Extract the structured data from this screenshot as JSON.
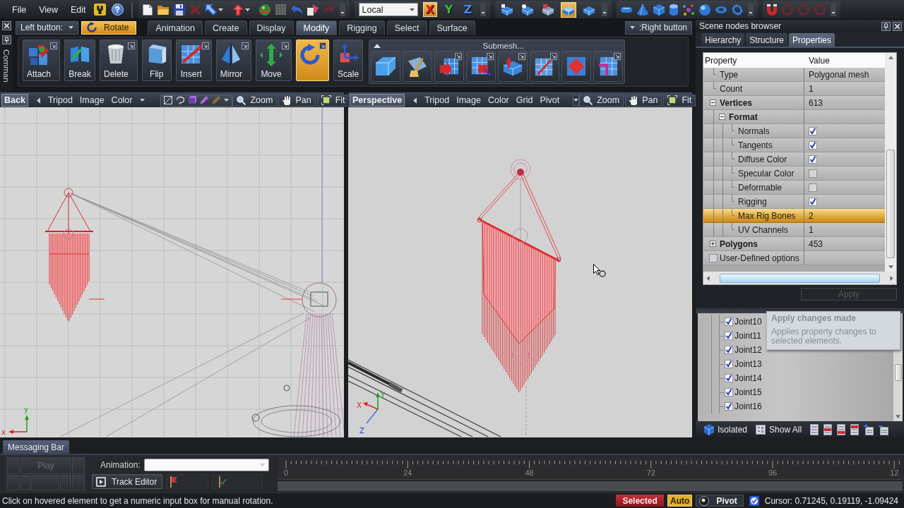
{
  "menu": {
    "items": [
      "File",
      "View",
      "Edit"
    ],
    "help": "?"
  },
  "toolbar": {
    "space": "Local",
    "axes": [
      {
        "label": "X",
        "selected": true
      },
      {
        "label": "Y",
        "selected": false
      },
      {
        "label": "Z",
        "selected": false
      }
    ],
    "selection_modes": [
      {
        "selected": false
      },
      {
        "selected": false
      },
      {
        "selected": false
      },
      {
        "selected": true
      },
      {
        "selected": false
      }
    ]
  },
  "command_panel": {
    "title": "Comman",
    "left_button": "Left button:",
    "left_tool": "Rotate",
    "right_button": ":Right button",
    "tabs": [
      {
        "label": "Animation",
        "selected": false
      },
      {
        "label": "Create",
        "selected": false
      },
      {
        "label": "Display",
        "selected": false
      },
      {
        "label": "Modify",
        "selected": true
      },
      {
        "label": "Rigging",
        "selected": false
      },
      {
        "label": "Select",
        "selected": false
      },
      {
        "label": "Surface",
        "selected": false
      }
    ],
    "tools": [
      {
        "kind": "attach",
        "label": "Attach",
        "options": true,
        "selected": false
      },
      {
        "kind": "break",
        "label": "Break",
        "options": false,
        "selected": false
      },
      {
        "kind": "delete",
        "label": "Delete",
        "options": true,
        "selected": false
      },
      {
        "kind": "flip",
        "label": "Flip",
        "options": false,
        "selected": false
      },
      {
        "kind": "insert",
        "label": "Insert",
        "options": true,
        "selected": false
      },
      {
        "kind": "mirror",
        "label": "Mirror",
        "options": true,
        "selected": false
      },
      {
        "kind": "move",
        "label": "Move",
        "options": true,
        "selected": false
      },
      {
        "kind": "rotate",
        "options": true,
        "selected": true
      },
      {
        "kind": "scale",
        "label": "Scale",
        "options": false,
        "selected": false
      }
    ],
    "submesh": {
      "title": "Submesh...",
      "tools": [
        {
          "options": false
        },
        {
          "options": false
        },
        {
          "options": true
        },
        {
          "options": true
        },
        {
          "options": true
        },
        {
          "options": true
        },
        {
          "options": false
        },
        {
          "options": true
        }
      ]
    }
  },
  "viewports": [
    {
      "kind": "orthographic",
      "label": "Back",
      "menu": [
        "Tripod",
        "Image",
        "Color"
      ],
      "tools": [
        "Zoom",
        "Pan",
        "Fit"
      ],
      "axis_labels": [
        "y",
        "x"
      ]
    },
    {
      "kind": "perspective",
      "label": "Perspective",
      "menu": [
        "Tripod",
        "Image",
        "Color",
        "Grid",
        "Pivot"
      ],
      "tools": [
        "Zoom",
        "Pan",
        "Fit"
      ],
      "axis_labels": [
        "Y",
        "X",
        "Z"
      ]
    }
  ],
  "scene_browser": {
    "title": "Scene nodes browser",
    "tabs": [
      {
        "label": "Hierarchy",
        "selected": false
      },
      {
        "label": "Structure",
        "selected": false
      },
      {
        "label": "Properties",
        "selected": true
      }
    ],
    "columns": [
      "Property",
      "Value"
    ],
    "properties": [
      {
        "name": "Type",
        "kind": "value",
        "value": "Polygonal mesh",
        "selected": false
      },
      {
        "name": "Count",
        "kind": "value",
        "value": "1",
        "selected": false
      },
      {
        "name": "Vertices",
        "kind": "group",
        "value": "613",
        "expanded": true,
        "selected": false,
        "children": [
          {
            "name": "Format",
            "kind": "group",
            "expanded": true,
            "selected": false,
            "children": [
              {
                "name": "Normals",
                "kind": "check",
                "checked": true,
                "selected": false
              },
              {
                "name": "Tangents",
                "kind": "check",
                "checked": true,
                "selected": false
              },
              {
                "name": "Diffuse Color",
                "kind": "check",
                "checked": true,
                "selected": false
              },
              {
                "name": "Specular Color",
                "kind": "check",
                "checked": false,
                "selected": false
              },
              {
                "name": "Deformable",
                "kind": "check",
                "checked": false,
                "selected": false
              },
              {
                "name": "Rigging",
                "kind": "check",
                "checked": true,
                "selected": false
              },
              {
                "name": "Max Rig Bones",
                "kind": "value",
                "value": "2",
                "selected": true
              },
              {
                "name": "UV Channels",
                "kind": "value",
                "value": "1",
                "selected": false
              }
            ]
          }
        ]
      },
      {
        "name": "Polygons",
        "kind": "group",
        "value": "453",
        "expanded": false,
        "selected": false
      },
      {
        "name": "User-Defined options",
        "kind": "option",
        "checked": false,
        "selected": false
      }
    ],
    "apply": {
      "label": "Apply",
      "disabled": true
    },
    "tooltip": {
      "title": "Apply changes made",
      "text": "Applies property changes to selected elements."
    },
    "nodes": [
      {
        "label": "Joint10",
        "checked": true
      },
      {
        "label": "Joint11",
        "checked": true
      },
      {
        "label": "Joint12",
        "checked": true
      },
      {
        "label": "Joint13",
        "checked": true
      },
      {
        "label": "Joint14",
        "checked": true
      },
      {
        "label": "Joint15",
        "checked": true
      },
      {
        "label": "Joint16",
        "checked": true
      }
    ],
    "actions": [
      "Isolated",
      "Show All"
    ]
  },
  "messaging_bar": {
    "title": "Messaging Bar",
    "play": {
      "label": "Play",
      "disabled": true
    },
    "animation_label": "Animation:",
    "track_editor": "Track Editor",
    "ticks": [
      "0",
      "24",
      "48",
      "72",
      "96",
      "12"
    ]
  },
  "status_bar": {
    "message": "Click on hovered element to get a numeric input box for manual rotation.",
    "badges": [
      {
        "kind": "selected",
        "label": "Selected"
      },
      {
        "kind": "auto",
        "label": "Auto"
      },
      {
        "kind": "pivot",
        "label": "Pivot"
      }
    ],
    "cursor": "Cursor: 0.71245, 0.19119, -1.09424"
  }
}
